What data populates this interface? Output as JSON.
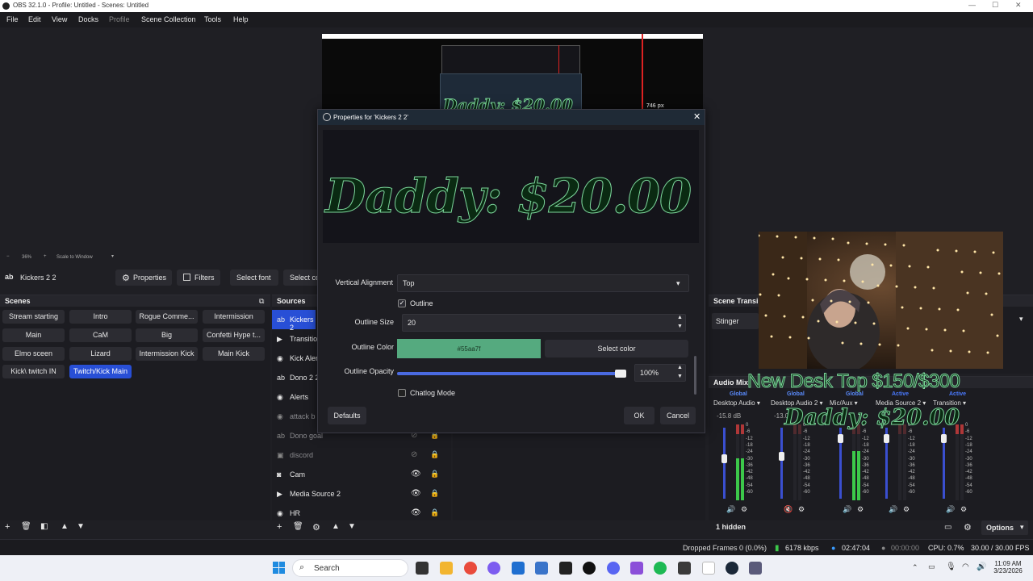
{
  "window": {
    "title": "OBS 32.1.0 - Profile: Untitled - Scenes: Untitled",
    "minimize": "—",
    "maximize": "☐",
    "close": "✕"
  },
  "menu": [
    "File",
    "Edit",
    "View",
    "Docks",
    "Profile",
    "Scene Collection",
    "Tools",
    "Help"
  ],
  "zoom": {
    "minus": "−",
    "value": "36%",
    "plus": "+",
    "mode": "Scale to Window"
  },
  "toolbar": {
    "source_name": "Kickers 2 2",
    "properties": "Properties",
    "filters": "Filters",
    "select_font": "Select font",
    "select_color": "Select co"
  },
  "scenes": {
    "title": "Scenes",
    "items": [
      "Stream starting",
      "Intro",
      "Rogue Comme...",
      "Intermission",
      "Main",
      "CaM",
      "Big",
      "Confetti Hype t...",
      "Elmo sceen",
      "Lizard",
      "Intermission Kick",
      "Main Kick",
      "Kick\\ twitch IN",
      "Twitch/Kick Main"
    ],
    "active_index": 13
  },
  "sources": {
    "title": "Sources",
    "items": [
      {
        "name": "Kickers 2",
        "icon": "text-icon",
        "dim": false
      },
      {
        "name": "Transitio",
        "icon": "play-icon",
        "dim": false
      },
      {
        "name": "Kick Aler",
        "icon": "browser-icon",
        "dim": false
      },
      {
        "name": "Dono 2 2",
        "icon": "text-icon",
        "dim": false
      },
      {
        "name": "Alerts",
        "icon": "browser-icon",
        "dim": false
      },
      {
        "name": "attack b",
        "icon": "browser-icon",
        "dim": true
      },
      {
        "name": "Dono goal",
        "icon": "text-icon",
        "dim": true
      },
      {
        "name": "discord",
        "icon": "window-icon",
        "dim": true
      },
      {
        "name": "Cam",
        "icon": "camera-icon",
        "dim": false
      },
      {
        "name": "Media Source 2",
        "icon": "play-icon",
        "dim": false
      },
      {
        "name": "HR",
        "icon": "browser-icon",
        "dim": false
      }
    ]
  },
  "dialog": {
    "title": "Properties for 'Kickers 2 2'",
    "preview_text": "Daddy: $20.00",
    "vertical_alignment_label": "Vertical Alignment",
    "vertical_alignment_value": "Top",
    "outline_label": "Outline",
    "outline_checked": true,
    "outline_size_label": "Outline Size",
    "outline_size_value": "20",
    "outline_color_label": "Outline Color",
    "outline_color_value": "#55aa7f",
    "select_color": "Select color",
    "outline_opacity_label": "Outline Opacity",
    "outline_opacity_value": "100%",
    "outline_opacity_fraction": 1.0,
    "chatlog_label": "Chatlog Mode",
    "chatlog_checked": false,
    "defaults": "Defaults",
    "ok": "OK",
    "cancel": "Cancel"
  },
  "transitions": {
    "title": "Scene Transi",
    "value": "Stinger"
  },
  "overlay": {
    "line1": "New Desk Top $150/$300",
    "line2": "Daddy: $20.00"
  },
  "audio": {
    "title": "Audio Mix",
    "channels": [
      {
        "name": "Desktop Audio",
        "tag": "Global",
        "db": "-15.8 dB"
      },
      {
        "name": "Desktop Audio 2",
        "tag": "Global",
        "db": "-13.0"
      },
      {
        "name": "Mic/Aux",
        "tag": "Global",
        "db": ""
      },
      {
        "name": "Media Source 2",
        "tag": "Active",
        "db": ""
      },
      {
        "name": "Transition",
        "tag": "Active",
        "db": ""
      }
    ],
    "scale": [
      "0",
      "-6",
      "-12",
      "-18",
      "-24",
      "-30",
      "-36",
      "-42",
      "-48",
      "-54",
      "-60"
    ],
    "hidden": "1 hidden",
    "options": "Options"
  },
  "canvas_preview": {
    "inner_text": "Daddy: $20.00",
    "px": "746 px"
  },
  "status": {
    "dropped": "Dropped Frames 0 (0.0%)",
    "kbps": "6178 kbps",
    "live": "02:47:04",
    "rec": "00:00:00",
    "cpu": "CPU: 0.7%",
    "fps": "30.00 / 30.00 FPS"
  },
  "taskbar": {
    "search": "Search",
    "time": "11:09 AM",
    "date": "3/23/2026"
  },
  "colors": {
    "accent": "#284fd6",
    "outline_green": "#55aa7f",
    "meter_green": "#3cc84a",
    "meter_red": "#d23c3c"
  }
}
